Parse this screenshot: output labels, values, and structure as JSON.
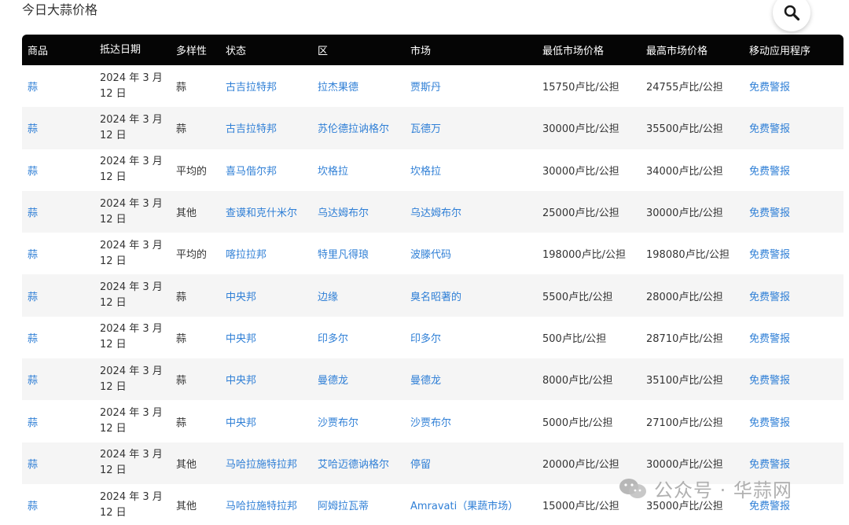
{
  "page": {
    "title": "今日大蒜价格"
  },
  "icons": {
    "search": "search-icon",
    "wechat": "wechat-icon"
  },
  "colors": {
    "header_bg": "#050505",
    "link": "#2f7fd6",
    "row_alt": "#f5f5f5"
  },
  "table": {
    "headers": [
      "商品",
      "抵达日期",
      "多样性",
      "状态",
      "区",
      "市场",
      "最低市场价格",
      "最高市场价格",
      "移动应用程序"
    ],
    "rows": [
      {
        "commodity": "蒜",
        "date": "2024 年 3 月 12 日",
        "variety": "蒜",
        "state": "古吉拉特邦",
        "district": "拉杰果德",
        "market": "贾斯丹",
        "min": "15750卢比/公担",
        "max": "24755卢比/公担",
        "app": "免费警报"
      },
      {
        "commodity": "蒜",
        "date": "2024 年 3 月 12 日",
        "variety": "蒜",
        "state": "古吉拉特邦",
        "district": "苏伦德拉讷格尔",
        "market": "瓦德万",
        "min": "30000卢比/公担",
        "max": "35500卢比/公担",
        "app": "免费警报"
      },
      {
        "commodity": "蒜",
        "date": "2024 年 3 月 12 日",
        "variety": "平均的",
        "state": "喜马偕尔邦",
        "district": "坎格拉",
        "market": "坎格拉",
        "min": "30000卢比/公担",
        "max": "34000卢比/公担",
        "app": "免费警报"
      },
      {
        "commodity": "蒜",
        "date": "2024 年 3 月 12 日",
        "variety": "其他",
        "state": "查谟和克什米尔",
        "district": "乌达姆布尔",
        "market": "乌达姆布尔",
        "min": "25000卢比/公担",
        "max": "30000卢比/公担",
        "app": "免费警报"
      },
      {
        "commodity": "蒜",
        "date": "2024 年 3 月 12 日",
        "variety": "平均的",
        "state": "喀拉拉邦",
        "district": "特里凡得琅",
        "market": "波滕代码",
        "min": "198000卢比/公担",
        "max": "198080卢比/公担",
        "app": "免费警报"
      },
      {
        "commodity": "蒜",
        "date": "2024 年 3 月 12 日",
        "variety": "蒜",
        "state": "中央邦",
        "district": "边缘",
        "market": "臭名昭著的",
        "min": "5500卢比/公担",
        "max": "28000卢比/公担",
        "app": "免费警报"
      },
      {
        "commodity": "蒜",
        "date": "2024 年 3 月 12 日",
        "variety": "蒜",
        "state": "中央邦",
        "district": "印多尔",
        "market": "印多尔",
        "min": "500卢比/公担",
        "max": "28710卢比/公担",
        "app": "免费警报"
      },
      {
        "commodity": "蒜",
        "date": "2024 年 3 月 12 日",
        "variety": "蒜",
        "state": "中央邦",
        "district": "曼德龙",
        "market": "曼德龙",
        "min": "8000卢比/公担",
        "max": "35100卢比/公担",
        "app": "免费警报"
      },
      {
        "commodity": "蒜",
        "date": "2024 年 3 月 12 日",
        "variety": "蒜",
        "state": "中央邦",
        "district": "沙贾布尔",
        "market": "沙贾布尔",
        "min": "5000卢比/公担",
        "max": "27100卢比/公担",
        "app": "免费警报"
      },
      {
        "commodity": "蒜",
        "date": "2024 年 3 月 12 日",
        "variety": "其他",
        "state": "马哈拉施特拉邦",
        "district": "艾哈迈德讷格尔",
        "market": "停留",
        "min": "20000卢比/公担",
        "max": "30000卢比/公担",
        "app": "免费警报"
      },
      {
        "commodity": "蒜",
        "date": "2024 年 3 月 12 日",
        "variety": "其他",
        "state": "马哈拉施特拉邦",
        "district": "阿姆拉瓦蒂",
        "market": "Amravati（果蔬市场）",
        "min": "15000卢比/公担",
        "max": "35000卢比/公担",
        "app": "免费警报"
      }
    ]
  },
  "watermark": {
    "text": "公众号 · 华蒜网"
  }
}
